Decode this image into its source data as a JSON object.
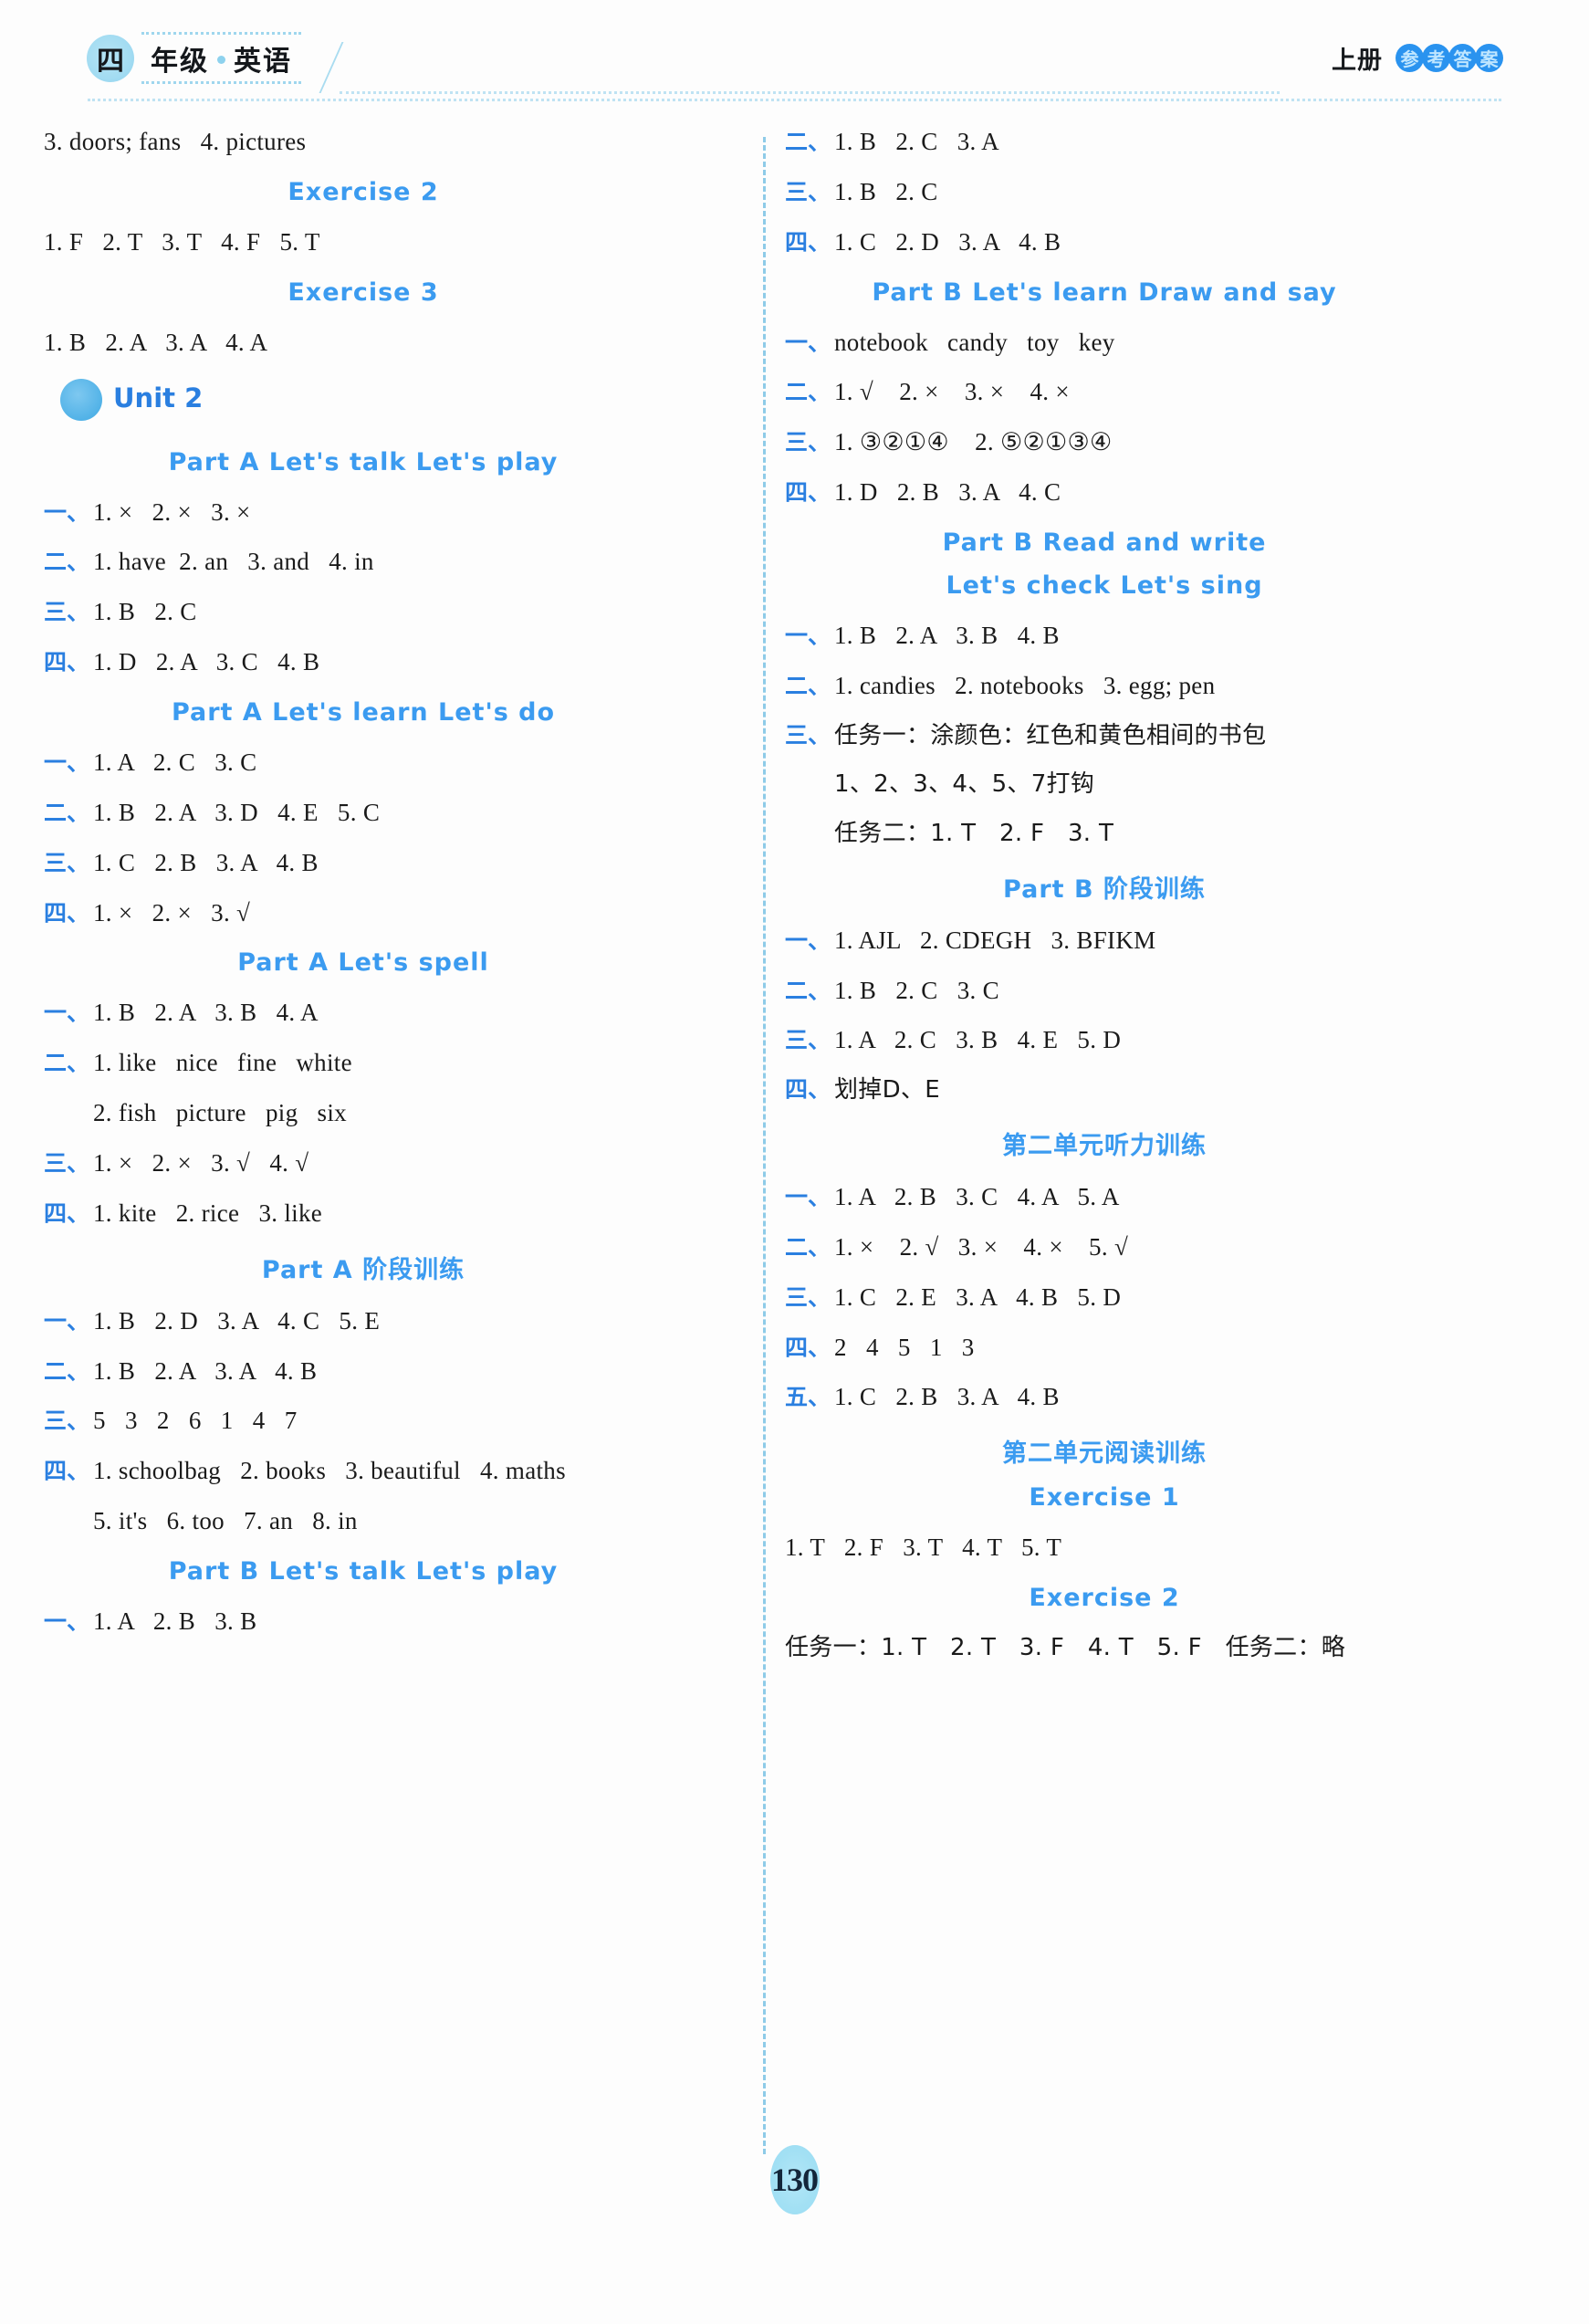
{
  "header": {
    "grade_badge": "四",
    "grade_word": "年级",
    "subject": "英语",
    "book": "上册",
    "answer_label_chars": [
      "参",
      "考",
      "答",
      "案"
    ]
  },
  "page_number": "130",
  "left_column": [
    {
      "kind": "answer",
      "num": "",
      "text": "3. doors; fans   4. pictures"
    },
    {
      "kind": "section",
      "text": "Exercise 2"
    },
    {
      "kind": "answer",
      "num": "",
      "text": "1. F   2. T   3. T   4. F   5. T"
    },
    {
      "kind": "section",
      "text": "Exercise 3"
    },
    {
      "kind": "answer",
      "num": "",
      "text": "1. B   2. A   3. A   4. A"
    },
    {
      "kind": "unit",
      "text": "Unit 2"
    },
    {
      "kind": "section",
      "text": "Part A   Let's talk   Let's play"
    },
    {
      "kind": "answer",
      "num": "一、",
      "text": "1. ×   2. ×   3. ×"
    },
    {
      "kind": "answer",
      "num": "二、",
      "text": "1. have  2. an   3. and   4. in"
    },
    {
      "kind": "answer",
      "num": "三、",
      "text": "1. B   2. C"
    },
    {
      "kind": "answer",
      "num": "四、",
      "text": "1. D   2. A   3. C   4. B"
    },
    {
      "kind": "section",
      "text": "Part A   Let's learn   Let's do"
    },
    {
      "kind": "answer",
      "num": "一、",
      "text": "1. A   2. C   3. C"
    },
    {
      "kind": "answer",
      "num": "二、",
      "text": "1. B   2. A   3. D   4. E   5. C"
    },
    {
      "kind": "answer",
      "num": "三、",
      "text": "1. C   2. B   3. A   4. B"
    },
    {
      "kind": "answer",
      "num": "四、",
      "text": "1. ×   2. ×   3. √"
    },
    {
      "kind": "section",
      "text": "Part A   Let's spell"
    },
    {
      "kind": "answer",
      "num": "一、",
      "text": "1. B   2. A   3. B   4. A"
    },
    {
      "kind": "answer",
      "num": "二、",
      "text": "1. like   nice   fine   white"
    },
    {
      "kind": "answer",
      "num": "",
      "text": "2. fish   picture   pig   six",
      "indent": true
    },
    {
      "kind": "answer",
      "num": "三、",
      "text": "1. ×   2. ×   3. √   4. √"
    },
    {
      "kind": "answer",
      "num": "四、",
      "text": "1. kite   2. rice   3. like"
    },
    {
      "kind": "section",
      "text": "Part A 阶段训练"
    },
    {
      "kind": "answer",
      "num": "一、",
      "text": "1. B   2. D   3. A   4. C   5. E"
    },
    {
      "kind": "answer",
      "num": "二、",
      "text": "1. B   2. A   3. A   4. B"
    },
    {
      "kind": "answer",
      "num": "三、",
      "text": "5   3   2   6   1   4   7"
    },
    {
      "kind": "answer",
      "num": "四、",
      "text": "1. schoolbag   2. books   3. beautiful   4. maths"
    },
    {
      "kind": "answer",
      "num": "",
      "text": "5. it's   6. too   7. an   8. in",
      "indent": true
    },
    {
      "kind": "section",
      "text": "Part B   Let's talk   Let's play"
    },
    {
      "kind": "answer",
      "num": "一、",
      "text": "1. A   2. B   3. B"
    }
  ],
  "right_column": [
    {
      "kind": "answer",
      "num": "二、",
      "text": "1. B   2. C   3. A"
    },
    {
      "kind": "answer",
      "num": "三、",
      "text": "1. B   2. C"
    },
    {
      "kind": "answer",
      "num": "四、",
      "text": "1. C   2. D   3. A   4. B"
    },
    {
      "kind": "section",
      "text": "Part B   Let's learn   Draw and say"
    },
    {
      "kind": "answer",
      "num": "一、",
      "text": "notebook   candy   toy   key"
    },
    {
      "kind": "answer",
      "num": "二、",
      "text": "1. √    2. ×    3. ×    4. ×"
    },
    {
      "kind": "answer",
      "num": "三、",
      "text": "1. ③②①④    2. ⑤②①③④"
    },
    {
      "kind": "answer",
      "num": "四、",
      "text": "1. D   2. B   3. A   4. C"
    },
    {
      "kind": "section",
      "text": "Part B   Read and write"
    },
    {
      "kind": "section2",
      "text": "Let's check   Let's sing"
    },
    {
      "kind": "answer",
      "num": "一、",
      "text": "1. B   2. A   3. B   4. B"
    },
    {
      "kind": "answer",
      "num": "二、",
      "text": "1. candies   2. notebooks   3. egg; pen"
    },
    {
      "kind": "answer",
      "num": "三、",
      "text": "任务一：涂颜色：红色和黄色相间的书包",
      "cn": true
    },
    {
      "kind": "answer",
      "num": "",
      "text": "1、2、3、4、5、7打钩",
      "indent": true,
      "cn": true
    },
    {
      "kind": "answer",
      "num": "",
      "text": "任务二：1. T   2. F   3. T",
      "indent": true,
      "cn": true
    },
    {
      "kind": "section",
      "text": "Part B 阶段训练"
    },
    {
      "kind": "answer",
      "num": "一、",
      "text": "1. AJL   2. CDEGH   3. BFIKM"
    },
    {
      "kind": "answer",
      "num": "二、",
      "text": "1. B   2. C   3. C"
    },
    {
      "kind": "answer",
      "num": "三、",
      "text": "1. A   2. C   3. B   4. E   5. D"
    },
    {
      "kind": "answer",
      "num": "四、",
      "text": "划掉D、E",
      "cn": true
    },
    {
      "kind": "section",
      "text": "第二单元听力训练"
    },
    {
      "kind": "answer",
      "num": "一、",
      "text": "1. A   2. B   3. C   4. A   5. A"
    },
    {
      "kind": "answer",
      "num": "二、",
      "text": "1. ×    2. √   3. ×    4. ×    5. √"
    },
    {
      "kind": "answer",
      "num": "三、",
      "text": "1. C   2. E   3. A   4. B   5. D"
    },
    {
      "kind": "answer",
      "num": "四、",
      "text": "2   4   5   1   3"
    },
    {
      "kind": "answer",
      "num": "五、",
      "text": "1. C   2. B   3. A   4. B"
    },
    {
      "kind": "section",
      "text": "第二单元阅读训练"
    },
    {
      "kind": "section2",
      "text": "Exercise 1"
    },
    {
      "kind": "answer",
      "num": "",
      "text": "1. T   2. F   3. T   4. T   5. T"
    },
    {
      "kind": "section",
      "text": "Exercise 2"
    },
    {
      "kind": "answer",
      "num": "",
      "text": "任务一：1. T   2. T   3. F   4. T   5. F   任务二：略",
      "cn": true
    }
  ]
}
